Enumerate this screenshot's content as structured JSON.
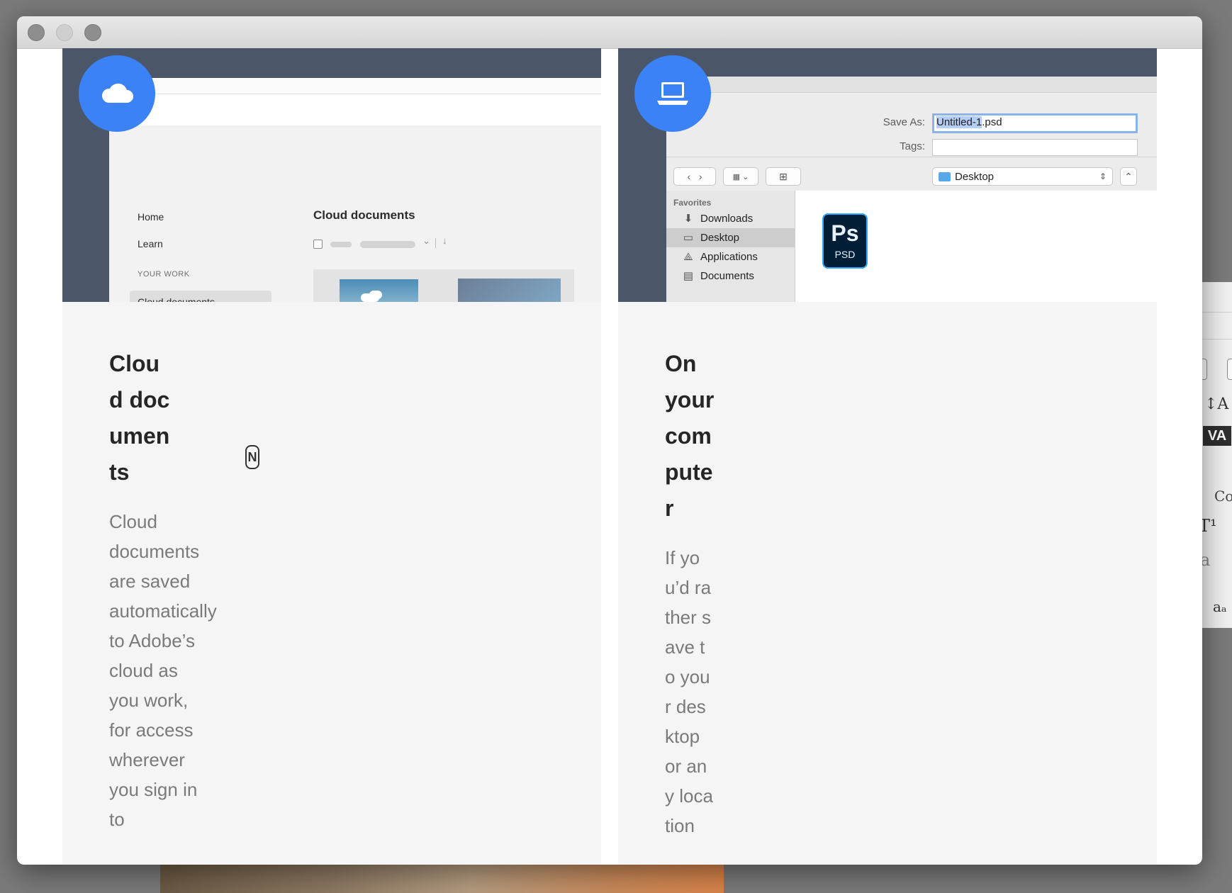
{
  "cloud_card": {
    "heading": "Cloud documents",
    "body": "Cloud documents are saved automatically to Adobe’s cloud as you work, for access wherever you sign in to",
    "preview": {
      "nav_home": "Home",
      "nav_learn": "Learn",
      "section": "YOUR WORK",
      "nav_selected": "Cloud documents",
      "title": "Cloud documents"
    },
    "cursor_glyph": "N"
  },
  "computer_card": {
    "heading": "On your computer",
    "body": "If you’d rather save to your desktop or any location",
    "preview": {
      "save_as_label": "Save As:",
      "save_as_value_selected": "Untitled-1",
      "save_as_value_rest": ".psd",
      "tags_label": "Tags:",
      "location": "Desktop",
      "favorites_header": "Favorites",
      "favorites": [
        "Downloads",
        "Desktop",
        "Applications",
        "Documents"
      ],
      "file_icon_big": "Ps",
      "file_icon_small": "PSD"
    }
  },
  "icons": {
    "cloud_badge": "cloud-icon",
    "computer_badge": "laptop-icon"
  },
  "colors": {
    "accent_blue": "#3b82f6",
    "preview_bg": "#4b5768",
    "ps_blue": "#31a8ff",
    "ps_dark": "#001e36"
  },
  "background_panel": {
    "text_co": "Co",
    "text_va": "VA"
  }
}
